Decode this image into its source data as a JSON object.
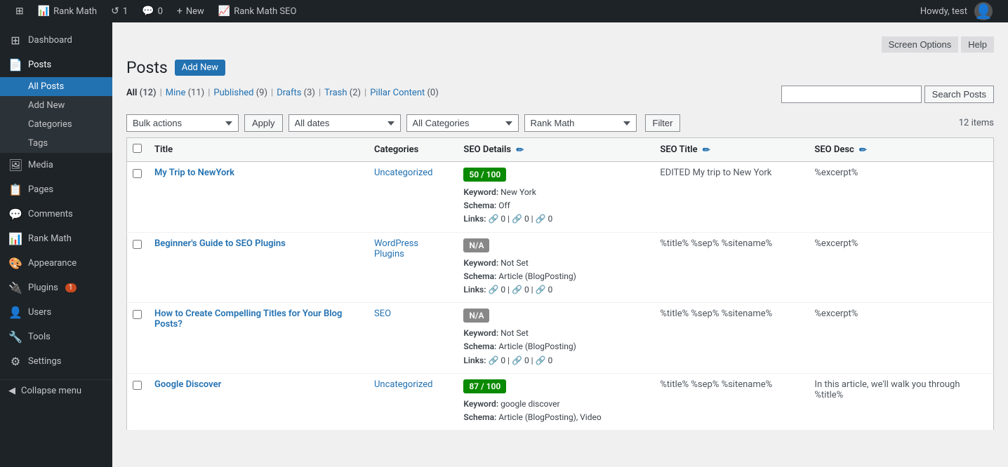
{
  "adminbar": {
    "items": [
      {
        "id": "wp-logo",
        "icon": "⊞",
        "label": ""
      },
      {
        "id": "rank-math",
        "icon": "📊",
        "label": "Rank Math"
      },
      {
        "id": "updates",
        "icon": "↺",
        "label": "1"
      },
      {
        "id": "comments",
        "icon": "💬",
        "label": "0"
      },
      {
        "id": "new",
        "icon": "+",
        "label": "New"
      },
      {
        "id": "rank-math-seo",
        "icon": "📈",
        "label": "Rank Math SEO"
      }
    ],
    "howdy": "Howdy, test"
  },
  "sidebar": {
    "items": [
      {
        "id": "dashboard",
        "icon": "⊞",
        "label": "Dashboard",
        "active": false
      },
      {
        "id": "posts",
        "icon": "📄",
        "label": "Posts",
        "active": true,
        "expanded": true
      },
      {
        "id": "media",
        "icon": "🖼",
        "label": "Media",
        "active": false
      },
      {
        "id": "pages",
        "icon": "📋",
        "label": "Pages",
        "active": false
      },
      {
        "id": "comments",
        "icon": "💬",
        "label": "Comments",
        "active": false
      },
      {
        "id": "rank-math",
        "icon": "📊",
        "label": "Rank Math",
        "active": false
      },
      {
        "id": "appearance",
        "icon": "🎨",
        "label": "Appearance",
        "active": false
      },
      {
        "id": "plugins",
        "icon": "🔌",
        "label": "Plugins",
        "active": false,
        "badge": "1"
      },
      {
        "id": "users",
        "icon": "👤",
        "label": "Users",
        "active": false
      },
      {
        "id": "tools",
        "icon": "🔧",
        "label": "Tools",
        "active": false
      },
      {
        "id": "settings",
        "icon": "⚙",
        "label": "Settings",
        "active": false
      }
    ],
    "posts_submenu": [
      {
        "id": "all-posts",
        "label": "All Posts",
        "active": true
      },
      {
        "id": "add-new",
        "label": "Add New",
        "active": false
      },
      {
        "id": "categories",
        "label": "Categories",
        "active": false
      },
      {
        "id": "tags",
        "label": "Tags",
        "active": false
      }
    ],
    "collapse_label": "Collapse menu"
  },
  "screen_options": "Screen Options",
  "help": "Help",
  "page": {
    "title": "Posts",
    "add_new_label": "Add New"
  },
  "subnav": {
    "items": [
      {
        "id": "all",
        "label": "All",
        "count": "12",
        "active": true
      },
      {
        "id": "mine",
        "label": "Mine",
        "count": "11"
      },
      {
        "id": "published",
        "label": "Published",
        "count": "9"
      },
      {
        "id": "drafts",
        "label": "Drafts",
        "count": "3"
      },
      {
        "id": "trash",
        "label": "Trash",
        "count": "2"
      },
      {
        "id": "pillar",
        "label": "Pillar Content",
        "count": "0"
      }
    ]
  },
  "search": {
    "placeholder": "",
    "button_label": "Search Posts"
  },
  "toolbar": {
    "bulk_actions_label": "Bulk actions",
    "apply_label": "Apply",
    "all_dates_label": "All dates",
    "all_categories_label": "All Categories",
    "rank_math_label": "Rank Math",
    "filter_label": "Filter",
    "items_count": "12 items"
  },
  "table": {
    "headers": [
      {
        "id": "title",
        "label": "Title"
      },
      {
        "id": "categories",
        "label": "Categories"
      },
      {
        "id": "seo-details",
        "label": "SEO Details",
        "editable": true
      },
      {
        "id": "seo-title",
        "label": "SEO Title",
        "editable": true
      },
      {
        "id": "seo-desc",
        "label": "SEO Desc",
        "editable": true
      }
    ],
    "rows": [
      {
        "id": 1,
        "title": "My Trip to NewYork",
        "categories": "Uncategorized",
        "seo_score": "50 / 100",
        "seo_score_class": "good",
        "keyword": "New York",
        "schema": "Off",
        "links_int": "0",
        "links_ext": "0",
        "links_aff": "0",
        "seo_title": "EDITED My trip to New York",
        "seo_desc": "%excerpt%"
      },
      {
        "id": 2,
        "title": "Beginner's Guide to SEO Plugins",
        "categories": "WordPress Plugins",
        "seo_score": "N/A",
        "seo_score_class": "na",
        "keyword": "Not Set",
        "schema": "Article (BlogPosting)",
        "links_int": "0",
        "links_ext": "0",
        "links_aff": "0",
        "seo_title": "%title% %sep% %sitename%",
        "seo_desc": "%excerpt%"
      },
      {
        "id": 3,
        "title": "How to Create Compelling Titles for Your Blog Posts?",
        "categories": "SEO",
        "seo_score": "N/A",
        "seo_score_class": "na",
        "keyword": "Not Set",
        "schema": "Article (BlogPosting)",
        "links_int": "0",
        "links_ext": "0",
        "links_aff": "0",
        "seo_title": "%title% %sep% %sitename%",
        "seo_desc": "%excerpt%"
      },
      {
        "id": 4,
        "title": "Google Discover",
        "categories": "Uncategorized",
        "seo_score": "87 / 100",
        "seo_score_class": "great",
        "keyword": "google discover",
        "schema": "Article (BlogPosting), Video",
        "links_int": "",
        "links_ext": "",
        "links_aff": "",
        "seo_title": "%title% %sep% %sitename%",
        "seo_desc": "In this article, we'll walk you through %title%"
      }
    ]
  }
}
